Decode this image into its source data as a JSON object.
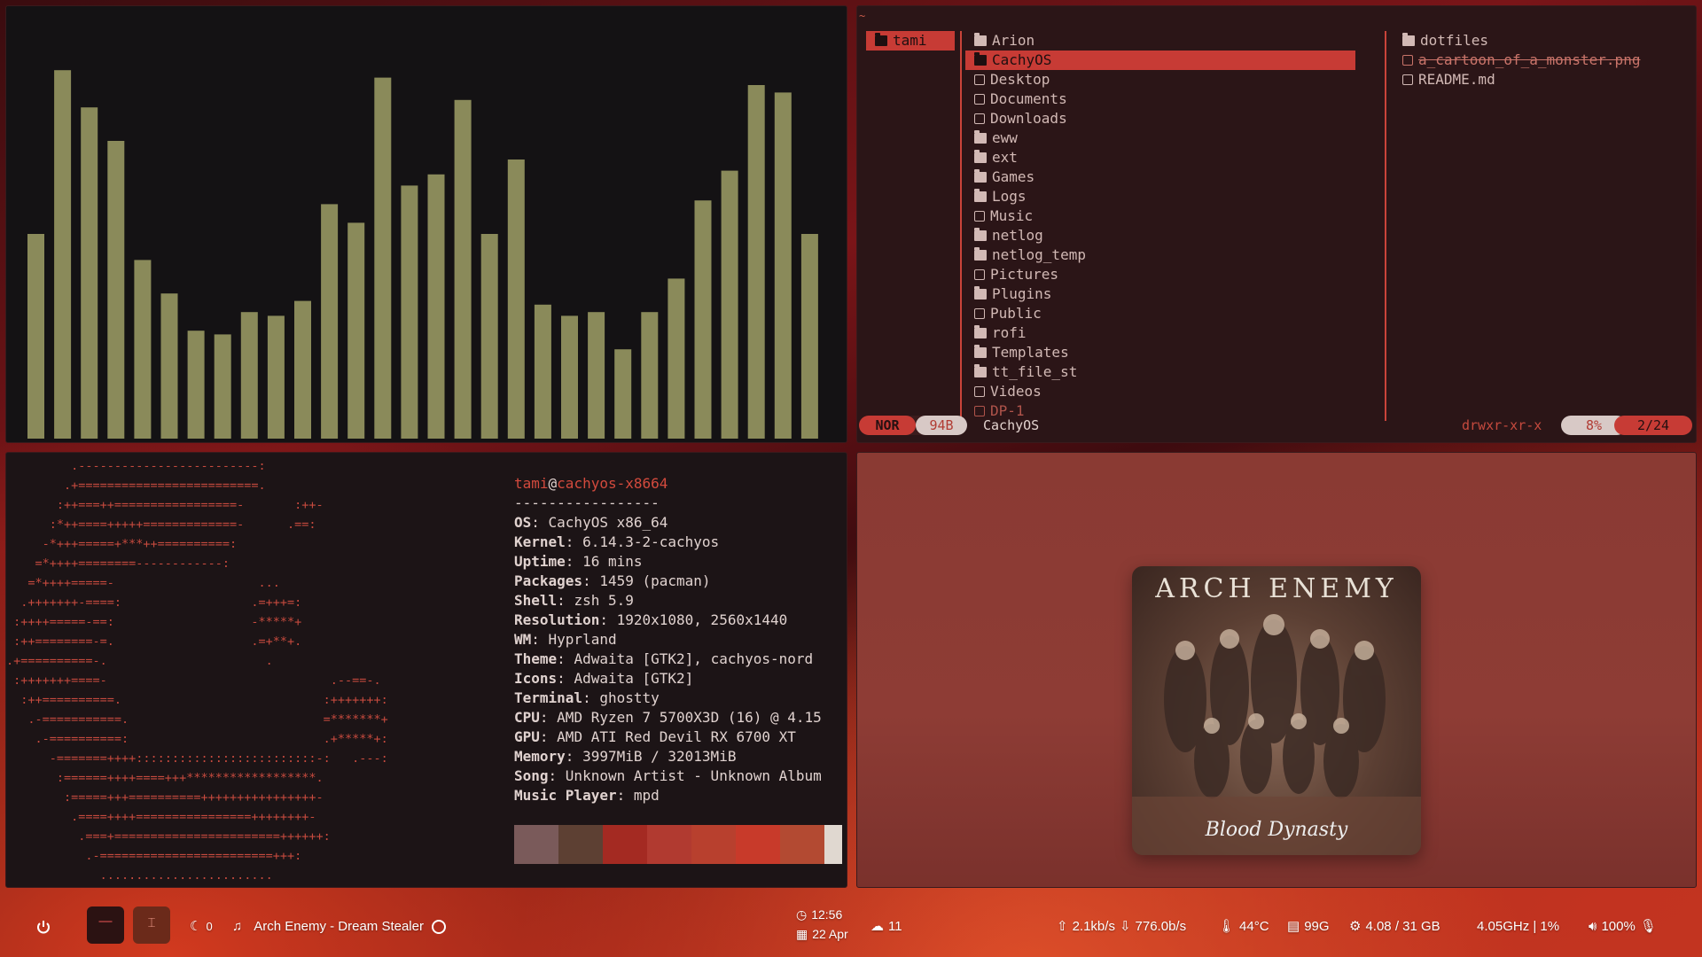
{
  "visualizer": {
    "bar_color": "#8a8a5a",
    "levels": [
      0.55,
      0.99,
      0.89,
      0.8,
      0.48,
      0.39,
      0.29,
      0.28,
      0.34,
      0.33,
      0.37,
      0.63,
      0.58,
      0.97,
      0.68,
      0.71,
      0.91,
      0.55,
      0.75,
      0.36,
      0.33,
      0.34,
      0.24,
      0.34,
      0.43,
      0.64,
      0.72,
      0.95,
      0.93,
      0.55
    ]
  },
  "file_manager": {
    "tilde": "~",
    "parent": [
      {
        "name": "tami",
        "selected": true
      }
    ],
    "current": [
      {
        "name": "Arion",
        "icon": "folder-icon"
      },
      {
        "name": "CachyOS",
        "icon": "folder-icon",
        "selected": true
      },
      {
        "name": "Desktop",
        "icon": "desktop-icon"
      },
      {
        "name": "Documents",
        "icon": "document-icon"
      },
      {
        "name": "Downloads",
        "icon": "download-icon"
      },
      {
        "name": "eww",
        "icon": "folder-icon"
      },
      {
        "name": "ext",
        "icon": "folder-icon"
      },
      {
        "name": "Games",
        "icon": "folder-icon"
      },
      {
        "name": "Logs",
        "icon": "folder-icon"
      },
      {
        "name": "Music",
        "icon": "headphones-icon"
      },
      {
        "name": "netlog",
        "icon": "folder-icon"
      },
      {
        "name": "netlog_temp",
        "icon": "folder-icon"
      },
      {
        "name": "Pictures",
        "icon": "picture-icon"
      },
      {
        "name": "Plugins",
        "icon": "folder-icon"
      },
      {
        "name": "Public",
        "icon": "public-icon"
      },
      {
        "name": "rofi",
        "icon": "folder-icon"
      },
      {
        "name": "Templates",
        "icon": "folder-icon"
      },
      {
        "name": "tt_file_st",
        "icon": "folder-icon"
      },
      {
        "name": "Videos",
        "icon": "video-icon"
      },
      {
        "name": "DP-1",
        "icon": "file-icon",
        "dim": true
      }
    ],
    "preview": [
      {
        "name": "dotfiles",
        "icon": "folder-icon"
      },
      {
        "name": "a_cartoon_of_a_monster.png",
        "icon": "image-icon",
        "link": true
      },
      {
        "name": "README.md",
        "icon": "file-icon"
      }
    ],
    "status": {
      "mode": "NOR",
      "size": "94B",
      "path": "CachyOS",
      "perms": "drwxr-xr-x",
      "percent": "8%",
      "position": "2/24"
    }
  },
  "neofetch": {
    "ascii": [
      "         .-------------------------:",
      "        .+=========================.",
      "       :++===++=================-       :++-",
      "      :*++====+++++=============-      .==:",
      "     -*+++=====+***++==========:",
      "    =*++++========------------:",
      "   =*++++=====-                    ...",
      "  .+++++++-====:                  .=+++=:",
      " :++++=====-==:                   -*****+",
      " :++========-=.                   .=+**+.",
      ".+==========-.                      .",
      " :+++++++====-                               .--==-.",
      "  :++==========.                            :+++++++:",
      "   .-===========.                           =*******+",
      "    .-==========:                           .+*****+:",
      "      -=======++++:::::::::::::::::::::::::-:   .---:",
      "       :======++++====+++******************.",
      "        :=====+++==========++++++++++++++++-",
      "         .====++++================++++++++-",
      "          .===+=======================++++++:",
      "           .-========================+++:",
      "             ........................"
    ],
    "user": "tami",
    "host": "cachyos-x8664",
    "separator": "-----------------",
    "fields": [
      {
        "k": "OS",
        "v": "CachyOS x86_64"
      },
      {
        "k": "Kernel",
        "v": "6.14.3-2-cachyos"
      },
      {
        "k": "Uptime",
        "v": "16 mins"
      },
      {
        "k": "Packages",
        "v": "1459 (pacman)"
      },
      {
        "k": "Shell",
        "v": "zsh 5.9"
      },
      {
        "k": "Resolution",
        "v": "1920x1080, 2560x1440"
      },
      {
        "k": "WM",
        "v": "Hyprland"
      },
      {
        "k": "Theme",
        "v": "Adwaita [GTK2], cachyos-nord"
      },
      {
        "k": "Icons",
        "v": "Adwaita [GTK2]"
      },
      {
        "k": "Terminal",
        "v": "ghostty"
      },
      {
        "k": "CPU",
        "v": "AMD Ryzen 7 5700X3D (16) @ 4.15"
      },
      {
        "k": "GPU",
        "v": "AMD ATI Red Devil RX 6700 XT"
      },
      {
        "k": "Memory",
        "v": "3997MiB / 32013MiB"
      },
      {
        "k": "Song",
        "v": "Unknown Artist - Unknown Album"
      },
      {
        "k": "Music Player",
        "v": "mpd"
      }
    ],
    "swatches": [
      "#7a5a5a",
      "#5d4033",
      "#a42a22",
      "#b13a30",
      "#b8402e",
      "#c83a2a",
      "#b34a32",
      "#e0d8d0"
    ]
  },
  "album": {
    "band": "ARCH ENEMY",
    "title": "Blood Dynasty"
  },
  "bar": {
    "ws1_icon": "—",
    "ws2_icon": "⌶",
    "notif_count": "0",
    "song": "Arch Enemy - Dream Stealer",
    "time": "12:56",
    "date": "22 Apr",
    "weather": "11",
    "up": "2.1kb/s",
    "down": "776.0b/s",
    "temp": "44°C",
    "disk": "99G",
    "mem": "4.08 / 31 GB",
    "cpu": "4.05GHz | 1%",
    "volume": "100%"
  }
}
